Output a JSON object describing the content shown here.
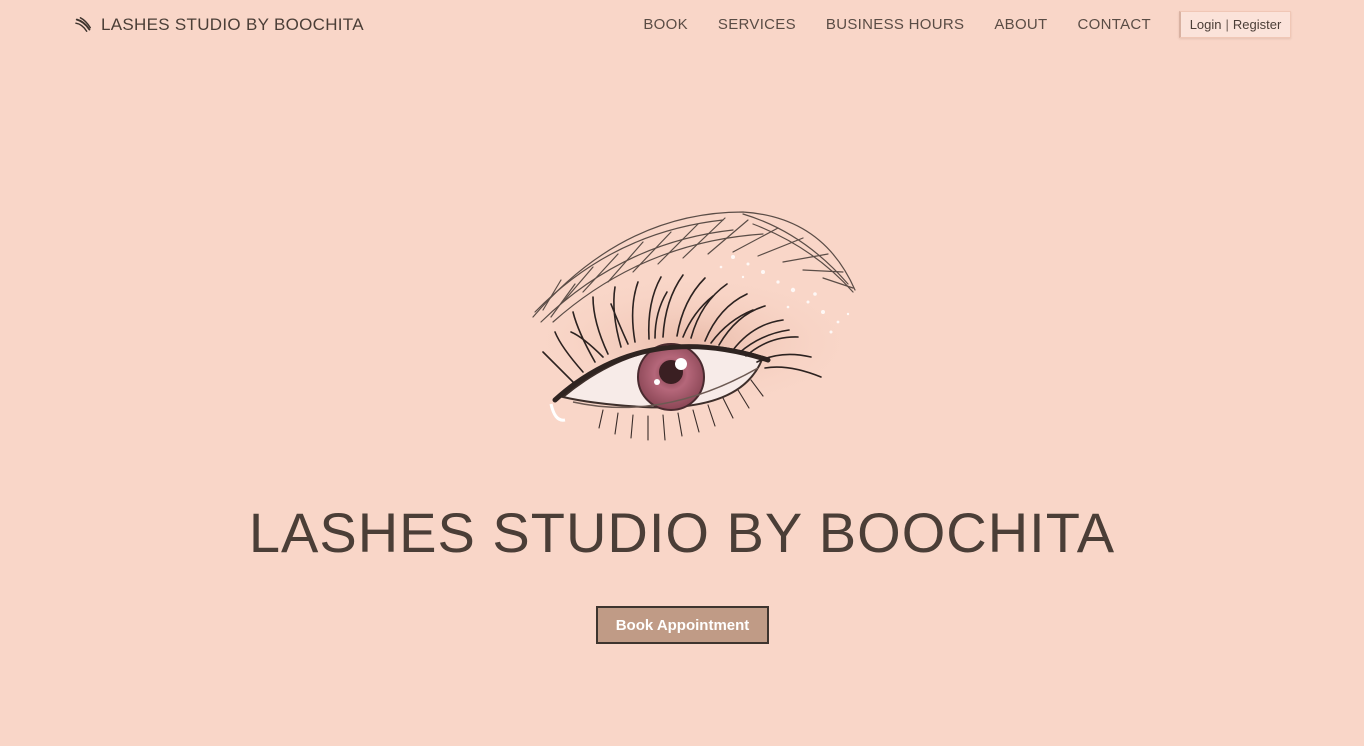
{
  "header": {
    "brand_name": "LASHES STUDIO BY BOOCHITA",
    "brand_icon": "lash-icon",
    "nav": [
      {
        "label": "BOOK"
      },
      {
        "label": "SERVICES"
      },
      {
        "label": "BUSINESS HOURS"
      },
      {
        "label": "ABOUT"
      },
      {
        "label": "CONTACT"
      }
    ],
    "auth": {
      "login_label": "Login",
      "separator": "|",
      "register_label": "Register"
    }
  },
  "hero": {
    "illustration": "eye-lash-illustration",
    "title": "LASHES STUDIO BY BOOCHITA",
    "cta_label": "Book Appointment"
  },
  "colors": {
    "background": "#f9d6c8",
    "text": "#4b3e37",
    "button_fill": "#c09b86",
    "button_border": "#3e342e",
    "iris": "#b5677a"
  }
}
